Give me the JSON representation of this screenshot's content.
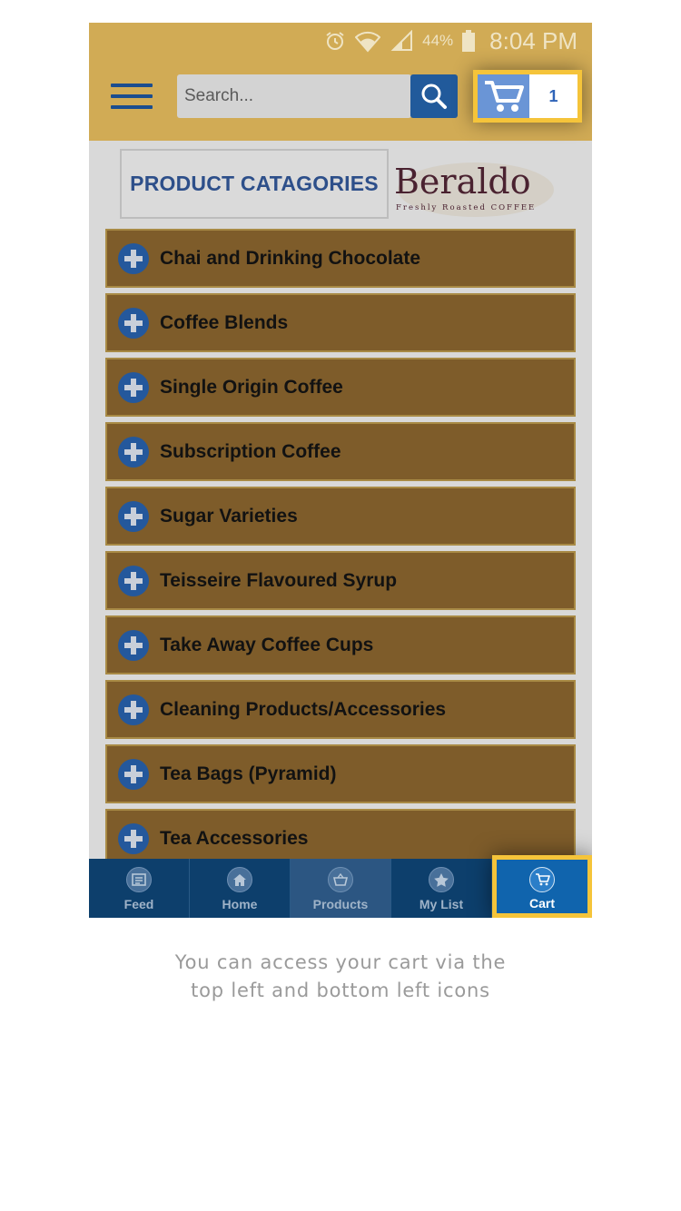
{
  "status_bar": {
    "battery_percent": "44%",
    "time": "8:04 PM",
    "icons": [
      "alarm-icon",
      "wifi-icon",
      "signal-icon",
      "battery-icon"
    ]
  },
  "header": {
    "menu_icon": "hamburger-menu-icon",
    "search": {
      "placeholder": "Search...",
      "value": ""
    },
    "search_button_icon": "search-icon",
    "cart": {
      "icon": "cart-icon",
      "count": "1"
    }
  },
  "category_header": {
    "title": "PRODUCT CATAGORIES",
    "logo": {
      "brand": "Beraldo",
      "tagline": "Freshly Roasted COFFEE"
    }
  },
  "categories": [
    {
      "label": "Chai and Drinking Chocolate"
    },
    {
      "label": "Coffee Blends"
    },
    {
      "label": "Single Origin Coffee"
    },
    {
      "label": "Subscription Coffee"
    },
    {
      "label": "Sugar Varieties"
    },
    {
      "label": "Teisseire Flavoured Syrup"
    },
    {
      "label": "Take Away Coffee Cups"
    },
    {
      "label": "Cleaning Products/Accessories"
    },
    {
      "label": "Tea Bags (Pyramid)"
    },
    {
      "label": "Tea Accessories"
    }
  ],
  "bottom_nav": {
    "items": [
      {
        "label": "Feed",
        "icon": "feed-icon"
      },
      {
        "label": "Home",
        "icon": "home-icon"
      },
      {
        "label": "Products",
        "icon": "basket-icon",
        "selected": true
      },
      {
        "label": "My List",
        "icon": "star-icon"
      },
      {
        "label": "Cart",
        "icon": "cart-icon",
        "highlighted": true
      }
    ]
  },
  "caption": {
    "line1": "You can access your cart via the",
    "line2": "top left and bottom left icons"
  },
  "colors": {
    "header_bg": "#d1ab55",
    "category_bg": "#7e5c2a",
    "accent_blue": "#215a9b",
    "highlight": "#f5c43a",
    "nav_bg": "#0d3f6c"
  }
}
